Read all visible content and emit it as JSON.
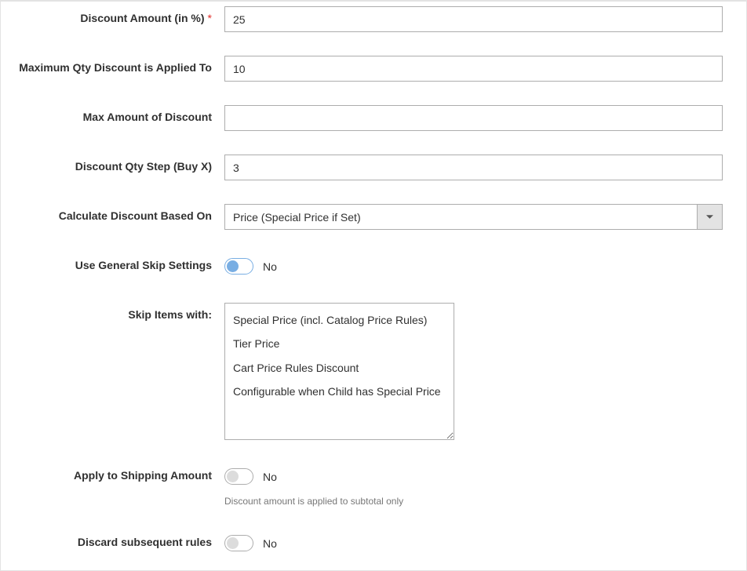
{
  "fields": {
    "discount_amount": {
      "label": "Discount Amount (in %)",
      "required": true,
      "value": "25"
    },
    "max_qty": {
      "label": "Maximum Qty Discount is Applied To",
      "value": "10"
    },
    "max_amount": {
      "label": "Max Amount of Discount",
      "value": ""
    },
    "qty_step": {
      "label": "Discount Qty Step (Buy X)",
      "value": "3"
    },
    "calc_based_on": {
      "label": "Calculate Discount Based On",
      "selected": "Price (Special Price if Set)"
    },
    "use_general_skip": {
      "label": "Use General Skip Settings",
      "state": "No"
    },
    "skip_items": {
      "label": "Skip Items with:",
      "options": [
        "Special Price (incl. Catalog Price Rules)",
        "Tier Price",
        "Cart Price Rules Discount",
        "Configurable when Child has Special Price"
      ]
    },
    "apply_shipping": {
      "label": "Apply to Shipping Amount",
      "state": "No",
      "hint": "Discount amount is applied to subtotal only"
    },
    "discard_subsequent": {
      "label": "Discard subsequent rules",
      "state": "No"
    }
  }
}
